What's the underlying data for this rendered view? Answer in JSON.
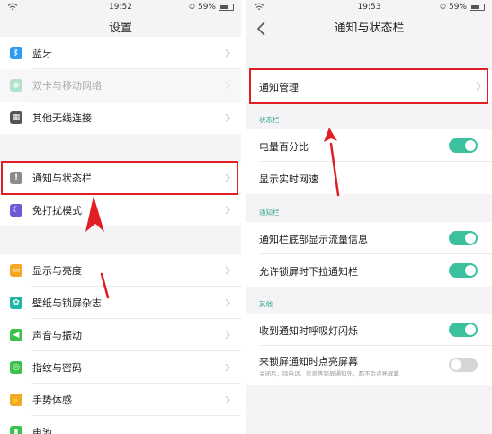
{
  "left": {
    "status": {
      "time": "19:52",
      "battery": "59%"
    },
    "title": "设置",
    "items": [
      {
        "label": "蓝牙",
        "color": "#2f9bf0",
        "glyph": "ᛒ"
      },
      {
        "label": "双卡与移动网络",
        "color": "#3cc17a",
        "glyph": "◉"
      },
      {
        "label": "其他无线连接",
        "color": "#555555",
        "glyph": "▦"
      },
      {
        "label": "通知与状态栏",
        "color": "#8c8c8c",
        "glyph": "!"
      },
      {
        "label": "免打扰模式",
        "color": "#6b5bd6",
        "glyph": "☾"
      },
      {
        "label": "显示与亮度",
        "color": "#f5a623",
        "glyph": "▭"
      },
      {
        "label": "壁纸与锁屏杂志",
        "color": "#1fb5a8",
        "glyph": "✿"
      },
      {
        "label": "声音与振动",
        "color": "#3cc14b",
        "glyph": "◀"
      },
      {
        "label": "指纹与密码",
        "color": "#3cc14b",
        "glyph": "◎"
      },
      {
        "label": "手势体感",
        "color": "#f5a623",
        "glyph": "✋"
      },
      {
        "label": "电池",
        "color": "#3cc14b",
        "glyph": "▮"
      }
    ]
  },
  "right": {
    "status": {
      "time": "19:53",
      "battery": "59%"
    },
    "title": "通知与状态栏",
    "notification_management": "通知管理",
    "sections": {
      "status_bar": "状态栏",
      "notification_bar": "通知栏",
      "other": "其他"
    },
    "rows": {
      "battery_percent": {
        "label": "电量百分比",
        "on": true
      },
      "realtime_speed": {
        "label": "显示实时网速"
      },
      "bottom_traffic": {
        "label": "通知栏底部显示流量信息",
        "on": true
      },
      "lockscreen_pull": {
        "label": "允许锁屏时下拉通知栏",
        "on": true
      },
      "breathing_light": {
        "label": "收到通知时呼吸灯闪烁",
        "on": true
      },
      "wake_screen": {
        "label": "来锁屏通知时点亮屏幕",
        "sub": "关闭后，除电话、信息等锁屏通知外，都不会点亮屏幕",
        "on": false
      }
    }
  },
  "colors": {
    "accent": "#3cc1a0",
    "highlight": "#e01e24"
  }
}
